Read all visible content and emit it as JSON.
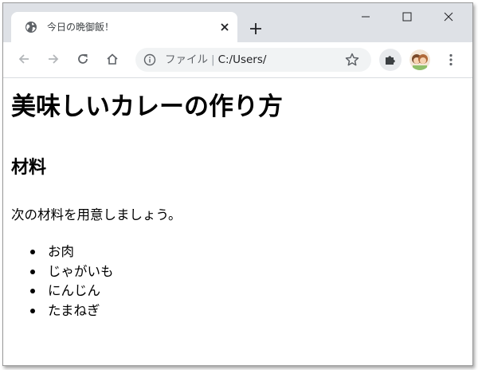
{
  "browser": {
    "tab": {
      "title": "今日の晩御飯！"
    },
    "address": {
      "scheme_label": "ファイル",
      "separator": "|",
      "url": "C:/Users/"
    }
  },
  "page": {
    "heading": "美味しいカレーの作り方",
    "section_heading": "材料",
    "intro": "次の材料を用意しましょう。",
    "ingredients": [
      "お肉",
      "じゃがいも",
      "にんじん",
      "たまねぎ"
    ]
  },
  "icons": {
    "tab_favicon": "globe-icon",
    "tab_close": "close-icon",
    "new_tab": "plus-icon",
    "minimize": "minimize-icon",
    "maximize": "maximize-icon",
    "close_window": "close-icon",
    "back": "back-arrow-icon",
    "forward": "forward-arrow-icon",
    "reload": "reload-icon",
    "home": "home-icon",
    "site_info": "info-icon",
    "bookmark": "star-icon",
    "extensions": "puzzle-icon",
    "profile": "avatar",
    "menu": "kebab-menu-icon"
  }
}
